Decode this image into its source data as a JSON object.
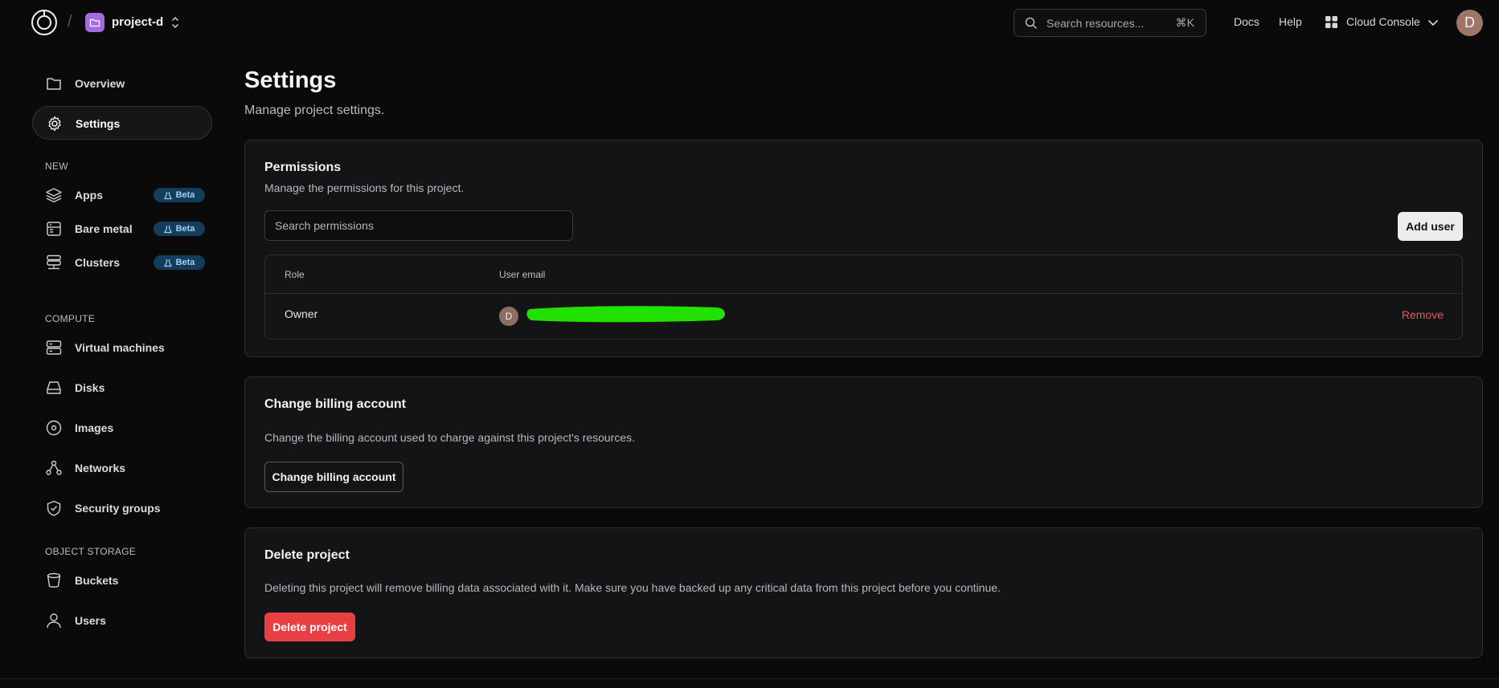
{
  "topbar": {
    "project_name": "project-d",
    "search_placeholder": "Search resources...",
    "search_shortcut": "⌘K",
    "docs_label": "Docs",
    "help_label": "Help",
    "console_label": "Cloud Console",
    "avatar_initial": "D"
  },
  "sidebar": {
    "items_top": [
      {
        "label": "Overview",
        "icon": "folder-icon"
      },
      {
        "label": "Settings",
        "icon": "gear-icon",
        "active": true
      }
    ],
    "sections": [
      {
        "heading": "NEW",
        "items": [
          {
            "label": "Apps",
            "icon": "layers-icon",
            "badge": "Beta"
          },
          {
            "label": "Bare metal",
            "icon": "server-chip-icon",
            "badge": "Beta"
          },
          {
            "label": "Clusters",
            "icon": "cluster-icon",
            "badge": "Beta"
          }
        ]
      },
      {
        "heading": "COMPUTE",
        "items": [
          {
            "label": "Virtual machines",
            "icon": "server-icon"
          },
          {
            "label": "Disks",
            "icon": "disk-icon"
          },
          {
            "label": "Images",
            "icon": "image-disc-icon"
          },
          {
            "label": "Networks",
            "icon": "network-icon"
          },
          {
            "label": "Security groups",
            "icon": "shield-icon"
          }
        ]
      },
      {
        "heading": "OBJECT STORAGE",
        "items": [
          {
            "label": "Buckets",
            "icon": "bucket-icon"
          },
          {
            "label": "Users",
            "icon": "user-icon"
          }
        ]
      }
    ]
  },
  "main": {
    "title": "Settings",
    "subtitle": "Manage project settings.",
    "permissions": {
      "title": "Permissions",
      "description": "Manage the permissions for this project.",
      "search_placeholder": "Search permissions",
      "add_user_label": "Add user",
      "columns": [
        "Role",
        "User email"
      ],
      "rows": [
        {
          "role": "Owner",
          "avatar_initial": "D",
          "action": "Remove"
        }
      ]
    },
    "billing": {
      "title": "Change billing account",
      "description": "Change the billing account used to charge against this project's resources.",
      "button_label": "Change billing account"
    },
    "delete": {
      "title": "Delete project",
      "description": "Deleting this project will remove billing data associated with it. Make sure you have backed up any critical data from this project before you continue.",
      "button_label": "Delete project"
    }
  },
  "colors": {
    "background": "#0a0a0b",
    "card": "#141416",
    "beta_badge": "#133d5a",
    "danger": "#e84042",
    "redaction": "#22e000"
  }
}
